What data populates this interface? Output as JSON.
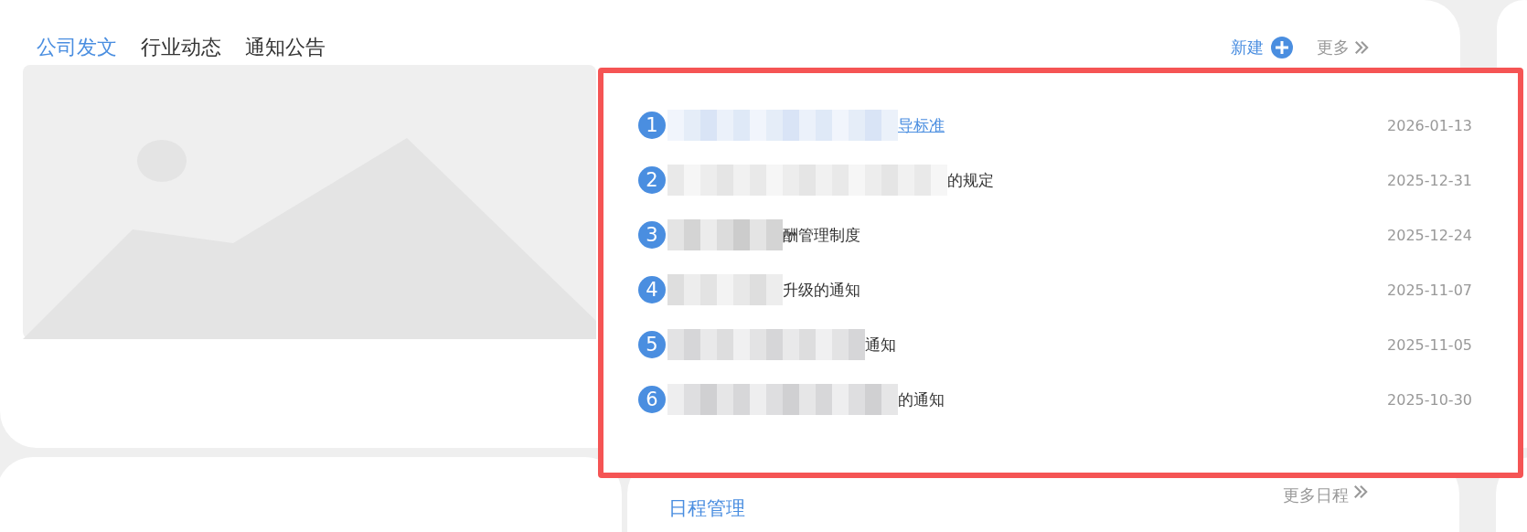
{
  "tabs": [
    {
      "label": "公司发文",
      "selected": true
    },
    {
      "label": "行业动态",
      "selected": false
    },
    {
      "label": "通知公告",
      "selected": false
    }
  ],
  "actions": {
    "new": "新建",
    "more": "更多"
  },
  "documents": [
    {
      "number": "1",
      "title": "导标准",
      "date": "2026-01-13",
      "selected": true
    },
    {
      "number": "2",
      "title": "的规定",
      "date": "2025-12-31",
      "selected": false
    },
    {
      "number": "3",
      "title": "酬管理制度",
      "date": "2025-12-24",
      "selected": false
    },
    {
      "number": "4",
      "title": "升级的通知",
      "date": "2025-11-07",
      "selected": false
    },
    {
      "number": "5",
      "title": "通知",
      "date": "2025-11-05",
      "selected": false
    },
    {
      "number": "6",
      "title": "的通知",
      "date": "2025-10-30",
      "selected": false
    }
  ],
  "schedule": {
    "title": "日程管理",
    "more": "更多日程"
  }
}
